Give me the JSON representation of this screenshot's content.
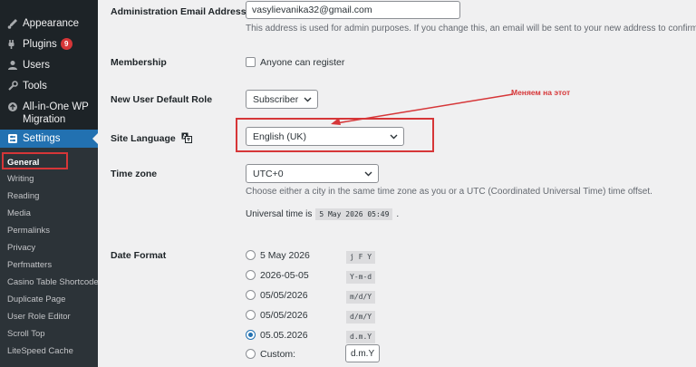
{
  "sidebar": {
    "items": [
      {
        "label": "Appearance",
        "icon": "appearance-icon"
      },
      {
        "label": "Plugins",
        "icon": "plugins-icon",
        "badge": "9"
      },
      {
        "label": "Users",
        "icon": "users-icon"
      },
      {
        "label": "Tools",
        "icon": "tools-icon"
      },
      {
        "label": "All-in-One WP Migration",
        "icon": "migration-icon"
      }
    ],
    "settings": {
      "label": "Settings",
      "icon": "settings-icon"
    },
    "submenu": [
      "General",
      "Writing",
      "Reading",
      "Media",
      "Permalinks",
      "Privacy",
      "Perfmatters",
      "Casino Table Shortcode",
      "Duplicate Page",
      "User Role Editor",
      "Scroll Top",
      "LiteSpeed Cache"
    ]
  },
  "form": {
    "admin_email": {
      "label": "Administration Email Address",
      "value": "vasylievanika32@gmail.com",
      "description": "This address is used for admin purposes. If you change this, an email will be sent to your new address to confirm it. The"
    },
    "membership": {
      "label": "Membership",
      "checkbox_label": "Anyone can register"
    },
    "default_role": {
      "label": "New User Default Role",
      "value": "Subscriber"
    },
    "site_language": {
      "label": "Site Language",
      "value": "English (UK)"
    },
    "timezone": {
      "label": "Time zone",
      "value": "UTC+0",
      "description": "Choose either a city in the same time zone as you or a UTC (Coordinated Universal Time) time offset.",
      "universal_prefix": "Universal time is",
      "universal_value": "5 May 2026 05:49",
      "universal_suffix": "."
    },
    "date_format": {
      "label": "Date Format",
      "options": [
        {
          "label": "5 May 2026",
          "code": "j F Y"
        },
        {
          "label": "2026-05-05",
          "code": "Y-m-d"
        },
        {
          "label": "05/05/2026",
          "code": "m/d/Y"
        },
        {
          "label": "05/05/2026",
          "code": "d/m/Y"
        },
        {
          "label": "05.05.2026",
          "code": "d.m.Y"
        }
      ],
      "custom_label": "Custom:",
      "custom_value": "d.m.Y"
    }
  },
  "annotation": {
    "text": "Меняем на этот",
    "color": "#d63638"
  },
  "colors": {
    "sidebar_bg": "#1d2327",
    "accent": "#2271b1",
    "highlight": "#d63638"
  }
}
